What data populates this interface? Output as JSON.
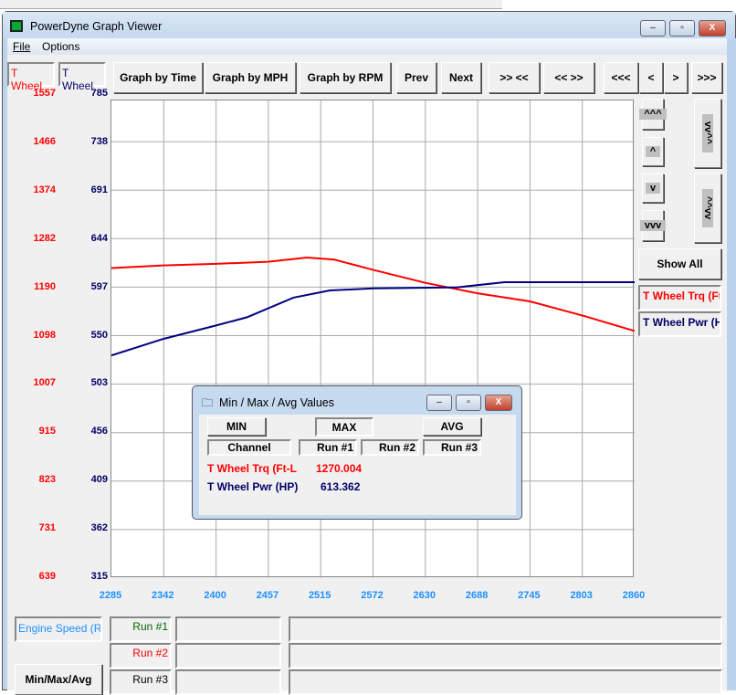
{
  "window": {
    "title": "PowerDyne Graph Viewer",
    "minimize": "–",
    "maximize": "▫",
    "close": "X"
  },
  "menu": [
    "File",
    "Options"
  ],
  "left_headers": {
    "torque": "T Wheel",
    "power": "T Wheel"
  },
  "toolbar": [
    "Graph by Time",
    "Graph by MPH",
    "Graph by RPM",
    "Prev",
    "Next",
    ">> <<",
    "<< >>",
    "<<<",
    "<",
    ">",
    ">>>"
  ],
  "right_panel": {
    "up3": "^^^",
    "up": "^",
    "down": "v",
    "down3": "vvv",
    "zoom_out": "vv^^",
    "zoom_in": "^^vv",
    "show_all": "Show All",
    "legend": [
      "T Wheel Trq (Ft-L",
      "T Wheel Pwr (HP"
    ]
  },
  "colors": {
    "torque": "#ff0000",
    "power": "#000080",
    "xaxis": "#1e90ff"
  },
  "chart_data": {
    "type": "line",
    "x_ticks": [
      "2285",
      "2342",
      "2400",
      "2457",
      "2515",
      "2572",
      "2630",
      "2688",
      "2745",
      "2803",
      "2860"
    ],
    "xlim": [
      2285,
      2860
    ],
    "y_left_ticks": [
      "1557",
      "1466",
      "1374",
      "1282",
      "1190",
      "1098",
      "1007",
      "915",
      "823",
      "731",
      "639"
    ],
    "y_left_lim": [
      639,
      1557
    ],
    "y_right_ticks": [
      "785",
      "738",
      "691",
      "644",
      "597",
      "550",
      "503",
      "456",
      "409",
      "362",
      "315"
    ],
    "y_right_lim": [
      315,
      785
    ],
    "grid": true,
    "series": [
      {
        "name": "T Wheel Trq (Ft-L",
        "axis": "left",
        "color": "#ff0000",
        "x": [
          2285,
          2342,
          2400,
          2457,
          2500,
          2530,
          2572,
          2630,
          2688,
          2745,
          2803,
          2860
        ],
        "y": [
          1238,
          1243,
          1246,
          1250,
          1258,
          1254,
          1235,
          1210,
          1190,
          1175,
          1148,
          1119
        ]
      },
      {
        "name": "T Wheel Pwr (HP",
        "axis": "right",
        "color": "#000080",
        "x": [
          2285,
          2342,
          2400,
          2434,
          2485,
          2525,
          2573,
          2665,
          2717,
          2860
        ],
        "y": [
          537,
          553,
          566,
          574,
          593,
          600,
          602,
          603,
          608,
          608
        ]
      }
    ]
  },
  "dialog": {
    "title": "Min / Max / Avg Values",
    "min": "MIN",
    "max": "MAX",
    "avg": "AVG",
    "headers": [
      "Channel",
      "Run #1",
      "Run #2",
      "Run #3"
    ],
    "rows": [
      {
        "channel": "T Wheel Trq (Ft-L",
        "run1": "1270.004"
      },
      {
        "channel": "T Wheel Pwr (HP)",
        "run1": "613.362"
      }
    ]
  },
  "bottom": {
    "channel": "Engine Speed (RI",
    "runs": [
      "Run #1",
      "Run #2",
      "Run #3"
    ],
    "minmax": "Min/Max/Avg"
  }
}
